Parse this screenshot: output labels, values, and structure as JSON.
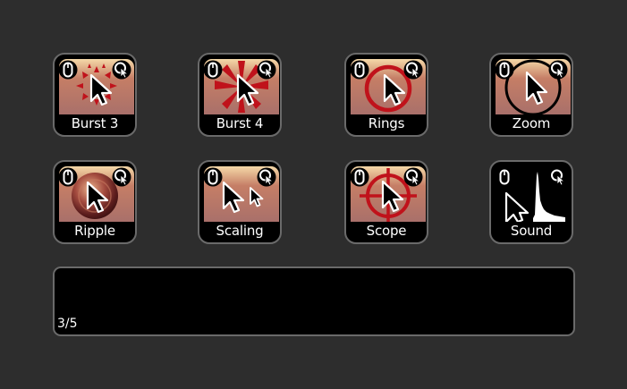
{
  "effects": [
    {
      "label": "Burst 3",
      "icon": "burst-3-icon"
    },
    {
      "label": "Burst 4",
      "icon": "burst-4-icon"
    },
    {
      "label": "Rings",
      "icon": "rings-icon"
    },
    {
      "label": "Zoom",
      "icon": "zoom-icon"
    },
    {
      "label": "Ripple",
      "icon": "ripple-icon"
    },
    {
      "label": "Scaling",
      "icon": "scaling-icon"
    },
    {
      "label": "Scope",
      "icon": "scope-icon"
    },
    {
      "label": "Sound",
      "icon": "sound-icon"
    }
  ],
  "status": {
    "page_indicator": "3/5"
  },
  "colors": {
    "background": "#2d2d2d",
    "tile_bg": "#000000",
    "tile_border": "#6a6a6a",
    "accent_red": "#c0121b"
  }
}
